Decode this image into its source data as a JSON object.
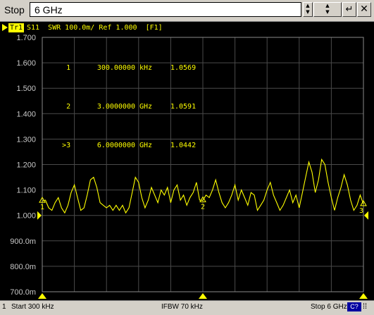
{
  "input_bar": {
    "label": "Stop",
    "value": "6 GHz",
    "spin_up": "▲",
    "spin_down": "▼",
    "step_up": "▲",
    "step_down": "▼",
    "enter_symbol": "↵",
    "close_symbol": "✕"
  },
  "trace": {
    "name": "Tr1",
    "description": "S11  SWR 100.0m/ Ref 1.000  [F1]"
  },
  "markers": [
    {
      "num": "1",
      "stimulus": "300.00000 kHz",
      "value": "1.0569"
    },
    {
      "num": "2",
      "stimulus": "3.0000000 GHz",
      "value": "1.0591"
    },
    {
      "num": ">3",
      "stimulus": "6.0000000 GHz",
      "value": "1.0442"
    }
  ],
  "marker_flags": [
    "1",
    "2",
    "3"
  ],
  "y_ticks": [
    "1.700",
    "1.600",
    "1.500",
    "1.400",
    "1.300",
    "1.200",
    "1.100",
    "1.000",
    "900.0m",
    "800.0m",
    "700.0m"
  ],
  "status": {
    "channel_num": "1",
    "start": "Start 300 kHz",
    "ifbw": "IFBW 70 kHz",
    "stop": "Stop 6 GHz",
    "channel_badge": "C?",
    "grip": "⁞⁞"
  },
  "colors": {
    "trace": "#ffff00",
    "grid": "#4a4a4a",
    "background": "#000000"
  },
  "chart_data": {
    "type": "line",
    "x_unit": "GHz",
    "xlim": [
      0.0003,
      6
    ],
    "ylim": [
      0.7,
      1.7
    ],
    "y_ticks": [
      1.7,
      1.6,
      1.5,
      1.4,
      1.3,
      1.2,
      1.1,
      1.0,
      0.9,
      0.8,
      0.7
    ],
    "reference": 1.0,
    "grid": true,
    "series": [
      {
        "x": [
          0.0003,
          0.06,
          0.12,
          0.18,
          0.24,
          0.3,
          0.36,
          0.42,
          0.48,
          0.54,
          0.6,
          0.66,
          0.72,
          0.78,
          0.84,
          0.9,
          0.96,
          1.02,
          1.08,
          1.14,
          1.2,
          1.26,
          1.32,
          1.38,
          1.44,
          1.5,
          1.56,
          1.62,
          1.68,
          1.74,
          1.8,
          1.86,
          1.92,
          1.98,
          2.04,
          2.1,
          2.16,
          2.22,
          2.28,
          2.34,
          2.4,
          2.46,
          2.52,
          2.58,
          2.64,
          2.7,
          2.76,
          2.82,
          2.88,
          2.94,
          3.0,
          3.06,
          3.12,
          3.18,
          3.24,
          3.3,
          3.36,
          3.42,
          3.48,
          3.54,
          3.6,
          3.66,
          3.72,
          3.78,
          3.84,
          3.9,
          3.96,
          4.02,
          4.08,
          4.14,
          4.2,
          4.26,
          4.32,
          4.38,
          4.44,
          4.5,
          4.56,
          4.62,
          4.68,
          4.74,
          4.8,
          4.86,
          4.92,
          4.98,
          5.04,
          5.1,
          5.16,
          5.22,
          5.28,
          5.34,
          5.4,
          5.46,
          5.52,
          5.58,
          5.64,
          5.7,
          5.76,
          5.82,
          5.88,
          5.94,
          6.0
        ],
        "y": [
          1.057,
          1.06,
          1.03,
          1.02,
          1.05,
          1.07,
          1.03,
          1.01,
          1.04,
          1.09,
          1.12,
          1.07,
          1.02,
          1.03,
          1.08,
          1.14,
          1.15,
          1.11,
          1.05,
          1.04,
          1.03,
          1.04,
          1.02,
          1.04,
          1.02,
          1.04,
          1.01,
          1.03,
          1.09,
          1.15,
          1.13,
          1.07,
          1.03,
          1.06,
          1.11,
          1.08,
          1.05,
          1.1,
          1.08,
          1.11,
          1.05,
          1.1,
          1.12,
          1.06,
          1.08,
          1.04,
          1.07,
          1.09,
          1.13,
          1.06,
          1.059,
          1.08,
          1.07,
          1.1,
          1.14,
          1.09,
          1.05,
          1.03,
          1.05,
          1.08,
          1.12,
          1.06,
          1.1,
          1.07,
          1.04,
          1.09,
          1.08,
          1.02,
          1.04,
          1.06,
          1.1,
          1.13,
          1.08,
          1.05,
          1.02,
          1.04,
          1.07,
          1.1,
          1.05,
          1.08,
          1.03,
          1.09,
          1.15,
          1.21,
          1.17,
          1.09,
          1.14,
          1.22,
          1.2,
          1.13,
          1.07,
          1.02,
          1.07,
          1.11,
          1.16,
          1.12,
          1.06,
          1.02,
          1.04,
          1.08,
          1.044
        ]
      }
    ]
  }
}
